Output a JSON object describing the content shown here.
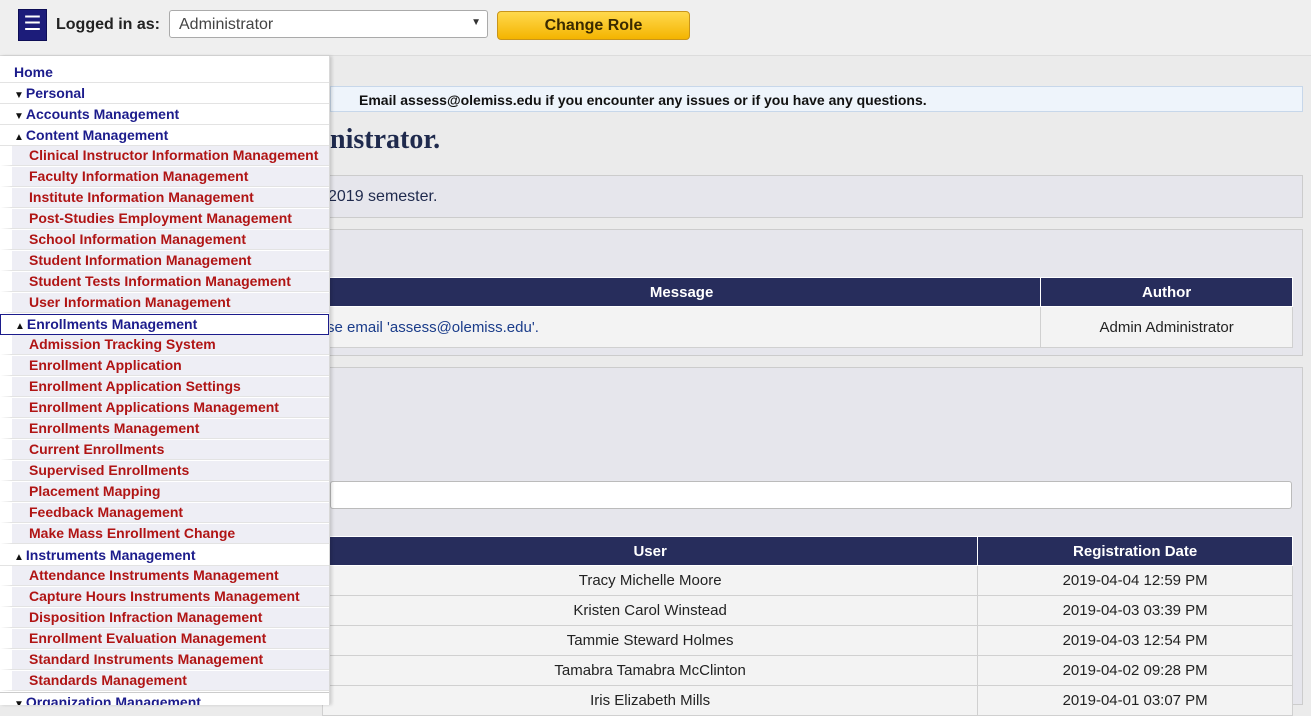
{
  "header": {
    "menu_icon": "☰",
    "logged_in_label": "Logged in as:",
    "role_value": "Administrator",
    "change_role_label": "Change Role"
  },
  "main": {
    "notice": "Email assess@olemiss.edu if you encounter any issues or if you have any questions.",
    "welcome_fragment": "nistrator.",
    "semester_fragment": "2019 semester.",
    "messages_table": {
      "headers": [
        "Message",
        "Author"
      ],
      "rows": [
        [
          "se email 'assess@olemiss.edu'.",
          "Admin Administrator"
        ]
      ]
    },
    "search_placeholder": "",
    "registrations_table": {
      "headers": [
        "User",
        "Registration Date"
      ],
      "rows": [
        [
          "Tracy Michelle Moore",
          "2019-04-04 12:59 PM"
        ],
        [
          "Kristen Carol Winstead",
          "2019-04-03 03:39 PM"
        ],
        [
          "Tammie Steward Holmes",
          "2019-04-03 12:54 PM"
        ],
        [
          "Tamabra Tamabra McClinton",
          "2019-04-02 09:28 PM"
        ],
        [
          "Iris Elizabeth Mills",
          "2019-04-01 03:07 PM"
        ]
      ]
    }
  },
  "sidebar": {
    "home": "Home",
    "personal": "Personal",
    "accounts": "Accounts Management",
    "content": "Content Management",
    "content_items": [
      "Clinical Instructor Information Management",
      "Faculty Information Management",
      "Institute Information Management",
      "Post-Studies Employment Management",
      "School Information Management",
      "Student Information Management",
      "Student Tests Information Management",
      "User Information Management"
    ],
    "enrollments": "Enrollments Management",
    "enrollment_items": [
      "Admission Tracking System",
      "Enrollment Application",
      "Enrollment Application Settings",
      "Enrollment Applications Management",
      "Enrollments Management",
      "Current Enrollments",
      "Supervised Enrollments",
      "Placement Mapping",
      "Feedback Management",
      "Make Mass Enrollment Change"
    ],
    "instruments": "Instruments Management",
    "instrument_items": [
      "Attendance Instruments Management",
      "Capture Hours Instruments Management",
      "Disposition Infraction Management",
      "Enrollment Evaluation Management",
      "Standard Instruments Management",
      "Standards Management"
    ],
    "organization": "Organization Management",
    "arrow_down": "▼",
    "arrow_up": "▲"
  }
}
